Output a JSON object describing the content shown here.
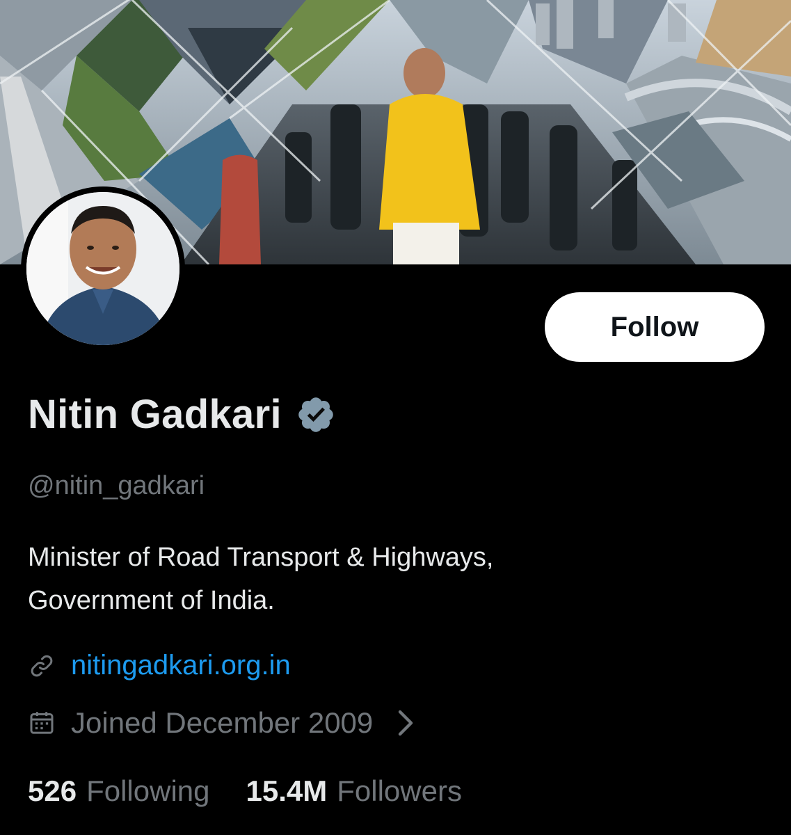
{
  "profile": {
    "name": "Nitin Gadkari",
    "handle": "@nitin_gadkari",
    "bio_line1": "Minister of Road Transport & Highways,",
    "bio_line2": "Government of India.",
    "website": "nitingadkari.org.in",
    "joined": "Joined December 2009",
    "verified": true
  },
  "actions": {
    "follow_label": "Follow"
  },
  "stats": {
    "following_count": "526",
    "following_label": "Following",
    "followers_count": "15.4M",
    "followers_label": "Followers"
  },
  "icons": {
    "verified": "verified-badge-icon",
    "link": "link-icon",
    "calendar": "calendar-icon",
    "chevron": "chevron-right-icon"
  },
  "colors": {
    "background": "#000000",
    "primary_text": "#e7e9ea",
    "secondary_text": "#71767b",
    "link": "#1d9bf0",
    "follow_bg": "#ffffff",
    "follow_text": "#0f1419",
    "verified_badge": "#829aab"
  }
}
